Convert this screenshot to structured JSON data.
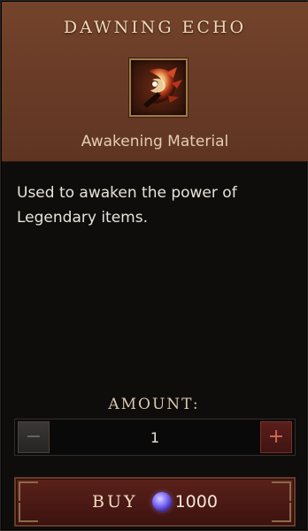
{
  "item": {
    "name": "DAWNING ECHO",
    "type": "Awakening Material",
    "description": "Used to awaken the power of Legendary items.",
    "icon": "dawning-echo-icon"
  },
  "purchase": {
    "amount_label": "AMOUNT:",
    "amount": "1",
    "minus_icon": "minus-icon",
    "plus_icon": "plus-icon",
    "buy_label": "BUY",
    "price": "1000",
    "currency_icon": "platinum-currency-icon"
  },
  "colors": {
    "header_bg": "#6a3c27",
    "panel_bg": "#0f0d0c",
    "buy_button": "#4b1914",
    "plus_button": "#5a1e1b",
    "title_text": "#f0d9b6",
    "currency": "#8d7bff"
  }
}
